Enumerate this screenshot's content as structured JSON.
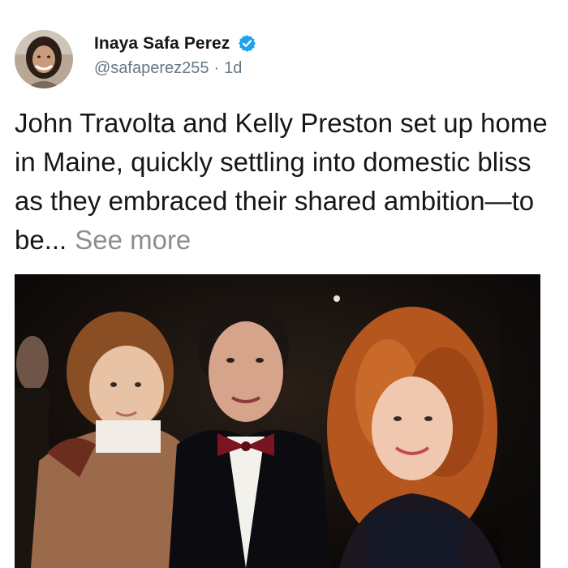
{
  "author": {
    "display_name": "Inaya Safa Perez",
    "handle": "@safaperez255",
    "separator": "·",
    "time_ago": "1d",
    "verified": true,
    "avatar_icon": "user-avatar"
  },
  "post": {
    "text": "John Travolta and Kelly Preston set up home in Maine, quickly settling into domestic bliss as they embraced their shared ambition—to be...",
    "see_more_label": "See more"
  },
  "colors": {
    "verified_blue": "#1da1f2",
    "text_primary": "#14171a",
    "text_secondary": "#657786",
    "see_more": "#8a8d91"
  }
}
